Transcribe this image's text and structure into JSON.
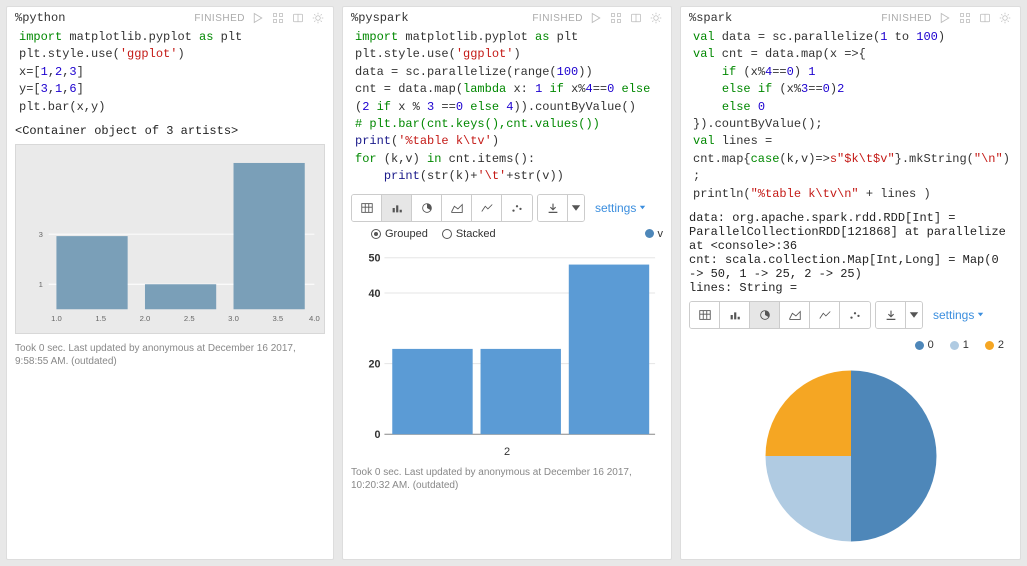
{
  "cells": [
    {
      "interpreter": "%python",
      "status": "FINISHED",
      "output_text": "<Container object of 3 artists>",
      "meta": "Took 0 sec. Last updated by anonymous at December 16 2017, 9:58:55 AM. (outdated)"
    },
    {
      "interpreter": "%pyspark",
      "status": "FINISHED",
      "settings_label": "settings",
      "legend": {
        "grouped": "Grouped",
        "stacked": "Stacked",
        "series": "v"
      },
      "xaxis_label": "2",
      "meta": "Took 0 sec. Last updated by anonymous at December 16 2017, 10:20:32 AM. (outdated)"
    },
    {
      "interpreter": "%spark",
      "status": "FINISHED",
      "output_text": "data: org.apache.spark.rdd.RDD[Int] = ParallelCollectionRDD[121868] at parallelize at <console>:36\ncnt: scala.collection.Map[Int,Long] = Map(0 -> 50, 1 -> 25, 2 -> 25)\nlines: String =",
      "settings_label": "settings",
      "legend": [
        "0",
        "1",
        "2"
      ]
    }
  ],
  "chart_data": [
    {
      "type": "bar",
      "title": "",
      "categories": [
        1,
        2,
        3
      ],
      "values": [
        3,
        1,
        6
      ],
      "xticks": [
        1.0,
        1.5,
        2.0,
        2.5,
        3.0,
        3.5,
        4.0
      ],
      "yticks": [
        1,
        3
      ],
      "ylim": [
        0,
        6.3
      ],
      "note": "matplotlib ggplot style bar"
    },
    {
      "type": "bar",
      "title": "",
      "series": [
        {
          "name": "v",
          "values": [
            25,
            25,
            50
          ]
        }
      ],
      "categories": [
        "",
        "2",
        ""
      ],
      "yticks": [
        0,
        20,
        40,
        50
      ],
      "ylim": [
        0,
        52
      ],
      "mode": "Grouped"
    },
    {
      "type": "pie",
      "series": [
        {
          "name": "0",
          "value": 50,
          "color": "#4e87b9"
        },
        {
          "name": "1",
          "value": 25,
          "color": "#b0cbe2"
        },
        {
          "name": "2",
          "value": 25,
          "color": "#f5a623"
        }
      ]
    }
  ],
  "colors": {
    "bar_blue": "#5b9bd5",
    "gg_bar": "#7a9fb8",
    "grid": "#e5e5e5",
    "settings": "#3b8ede"
  }
}
